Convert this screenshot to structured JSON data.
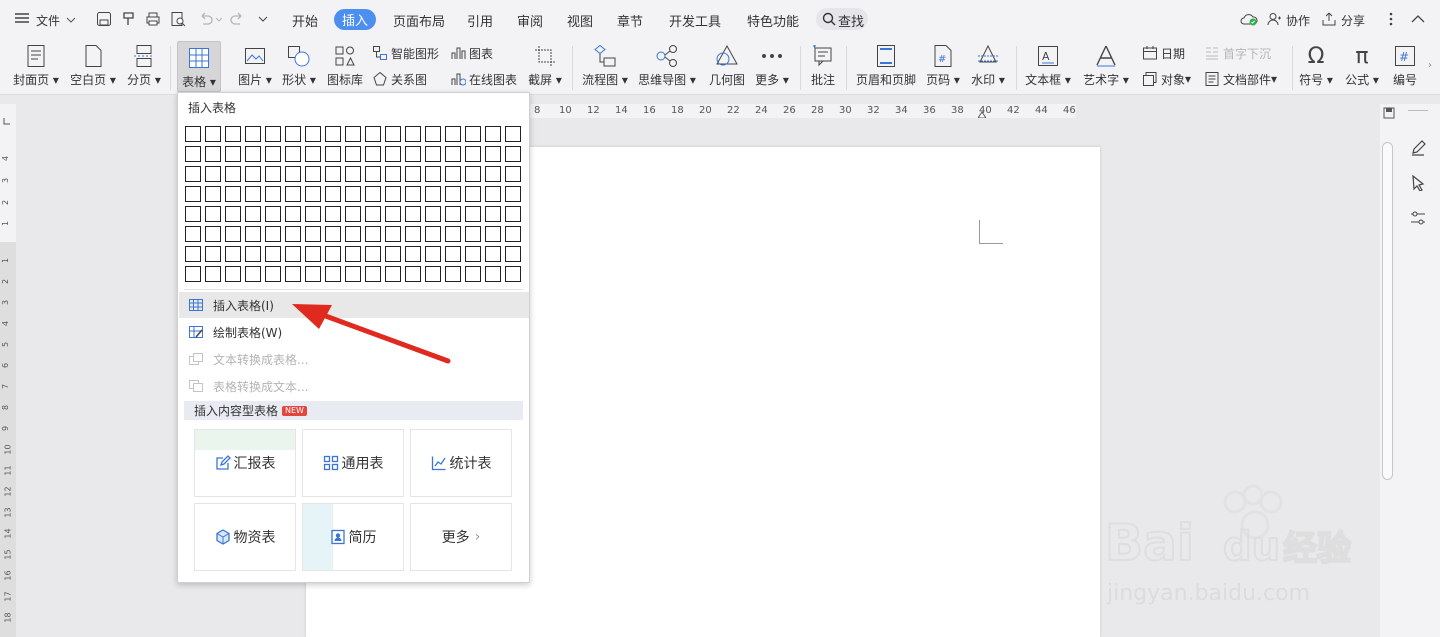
{
  "menubar": {
    "file_label": "文件",
    "tabs": [
      "开始",
      "插入",
      "页面布局",
      "引用",
      "审阅",
      "视图",
      "章节",
      "开发工具",
      "特色功能"
    ],
    "active_tab": "插入",
    "search_label": "查找",
    "collab_label": "协作",
    "share_label": "分享"
  },
  "ribbon": {
    "big_buttons": [
      {
        "label": "封面页",
        "icon": "cover-page-icon"
      },
      {
        "label": "空白页",
        "icon": "blank-page-icon"
      },
      {
        "label": "分页",
        "icon": "page-break-icon"
      },
      {
        "label": "表格",
        "icon": "table-icon"
      },
      {
        "label": "图片",
        "icon": "picture-icon"
      },
      {
        "label": "形状",
        "icon": "shapes-icon"
      },
      {
        "label": "图标库",
        "icon": "icon-library-icon"
      }
    ],
    "small_buttons_a": [
      {
        "label": "智能图形",
        "icon": "smart-graphic-icon"
      },
      {
        "label": "关系图",
        "icon": "relation-diagram-icon"
      }
    ],
    "small_buttons_b": [
      {
        "label": "图表",
        "icon": "chart-icon"
      },
      {
        "label": "在线图表",
        "icon": "online-chart-icon"
      }
    ],
    "big_buttons_2": [
      {
        "label": "截屏",
        "icon": "screenshot-icon"
      },
      {
        "label": "流程图",
        "icon": "flowchart-icon"
      },
      {
        "label": "思维导图",
        "icon": "mindmap-icon"
      },
      {
        "label": "几何图",
        "icon": "geometry-icon"
      },
      {
        "label": "更多",
        "icon": "more-icon"
      },
      {
        "label": "批注",
        "icon": "comment-icon"
      },
      {
        "label": "页眉和页脚",
        "icon": "header-footer-icon"
      },
      {
        "label": "页码",
        "icon": "page-number-icon"
      },
      {
        "label": "水印",
        "icon": "watermark-icon"
      },
      {
        "label": "文本框",
        "icon": "textbox-icon"
      },
      {
        "label": "艺术字",
        "icon": "wordart-icon"
      }
    ],
    "small_buttons_c": [
      {
        "label": "日期",
        "icon": "date-icon"
      },
      {
        "label": "对象",
        "icon": "object-icon"
      }
    ],
    "small_buttons_d": [
      {
        "label": "首字下沉",
        "icon": "drop-cap-icon",
        "disabled": true
      },
      {
        "label": "文档部件",
        "icon": "doc-parts-icon"
      }
    ],
    "big_buttons_3": [
      {
        "label": "符号",
        "icon": "symbol-icon"
      },
      {
        "label": "公式",
        "icon": "formula-icon"
      },
      {
        "label": "编号",
        "icon": "numbering-icon"
      }
    ]
  },
  "hruler_ticks": [
    "8",
    "10",
    "12",
    "14",
    "16",
    "18",
    "20",
    "22",
    "24",
    "26",
    "28",
    "30",
    "32",
    "34",
    "36",
    "38",
    "40",
    "42",
    "44",
    "46"
  ],
  "vruler_ticks_top": [
    "4",
    "3",
    "2",
    "1"
  ],
  "vruler_ticks": [
    "1",
    "2",
    "3",
    "4",
    "5",
    "6",
    "7",
    "8",
    "9",
    "10",
    "11",
    "12",
    "13",
    "14",
    "15",
    "16",
    "17",
    "18"
  ],
  "dropdown": {
    "title": "插入表格",
    "grid_cols": 17,
    "grid_rows": 8,
    "items": [
      {
        "label": "插入表格(I)",
        "icon": "insert-table-icon",
        "disabled": false,
        "highlighted": true
      },
      {
        "label": "绘制表格(W)",
        "icon": "draw-table-icon",
        "disabled": false
      },
      {
        "label": "文本转换成表格...",
        "icon": "text-to-table-icon",
        "disabled": true
      },
      {
        "label": "表格转换成文本...",
        "icon": "table-to-text-icon",
        "disabled": true
      }
    ],
    "section_label": "插入内容型表格",
    "new_badge": "NEW",
    "cards": [
      {
        "label": "汇报表",
        "icon": "report-table-icon"
      },
      {
        "label": "通用表",
        "icon": "general-table-icon"
      },
      {
        "label": "统计表",
        "icon": "stats-table-icon"
      },
      {
        "label": "物资表",
        "icon": "materials-table-icon"
      },
      {
        "label": "简历",
        "icon": "resume-icon"
      },
      {
        "label": "更多",
        "icon": "chevron-right-icon"
      }
    ]
  },
  "colors": {
    "accent": "#4d8ff0",
    "icon_blue": "#3b76d6",
    "arrow_red": "#e02a1f"
  }
}
